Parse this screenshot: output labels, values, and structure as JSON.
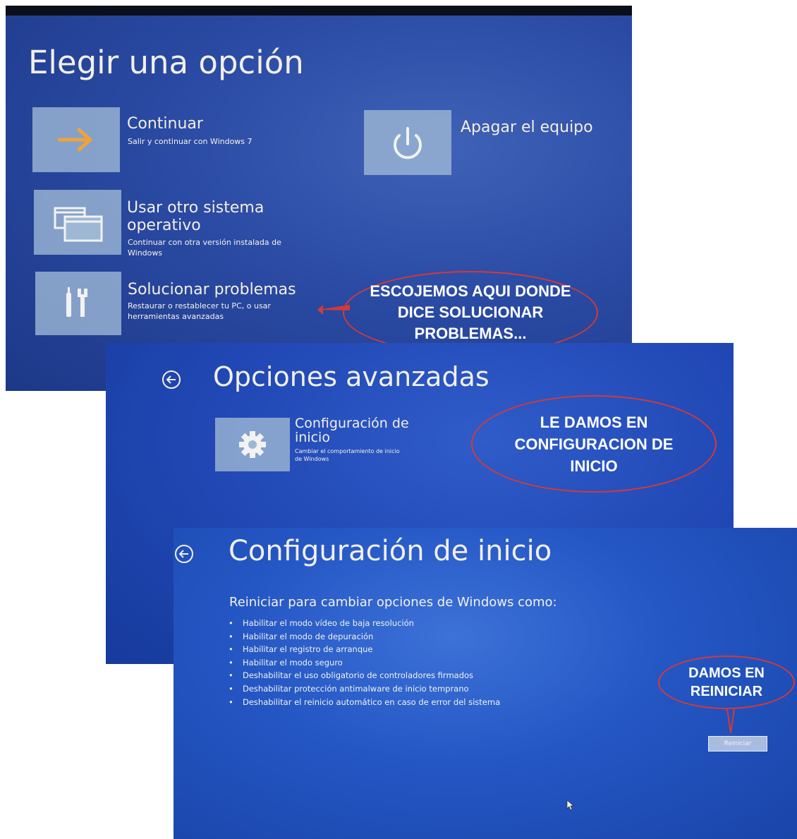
{
  "screen1": {
    "title": "Elegir una opción",
    "options": [
      {
        "title": "Continuar",
        "desc": "Salir y continuar con Windows 7",
        "icon": "arrow-right-icon"
      },
      {
        "title": "Usar otro sistema\noperativo",
        "desc": "Continuar con otra versión instalada de\nWindows",
        "icon": "windows-stack-icon"
      },
      {
        "title": "Solucionar problemas",
        "desc": "Restaurar o restablecer tu PC, o usar\nherramientas avanzadas",
        "icon": "tools-icon"
      },
      {
        "title": "Apagar el equipo",
        "icon": "power-icon"
      }
    ],
    "annotation": "ESCOJEMOS AQUI DONDE\nDICE SOLUCIONAR\nPROBLEMAS..."
  },
  "screen2": {
    "title": "Opciones avanzadas",
    "option": {
      "title": "Configuración de\ninicio",
      "desc": "Cambiar el comportamiento de inicio\nde Windows",
      "icon": "gear-icon"
    },
    "annotation": "LE DAMOS EN\nCONFIGURACION DE\nINICIO"
  },
  "screen3": {
    "title": "Configuración de inicio",
    "subtitle": "Reiniciar para cambiar opciones de Windows como:",
    "items": [
      "Habilitar el modo vídeo de baja resolución",
      "Habilitar el modo de depuración",
      "Habilitar el registro de arranque",
      "Habilitar el modo seguro",
      "Deshabilitar el uso obligatorio de controladores firmados",
      "Deshabilitar protección antimalware de inicio temprano",
      "Deshabilitar el reinicio automático en caso de error del sistema"
    ],
    "restart_label": "Reiniciar",
    "annotation": "DAMOS EN\nREINICIAR"
  },
  "colors": {
    "annotation_outline": "#d33a38",
    "tile": "#9eb8d4",
    "screen_blue": "#2456c4"
  }
}
